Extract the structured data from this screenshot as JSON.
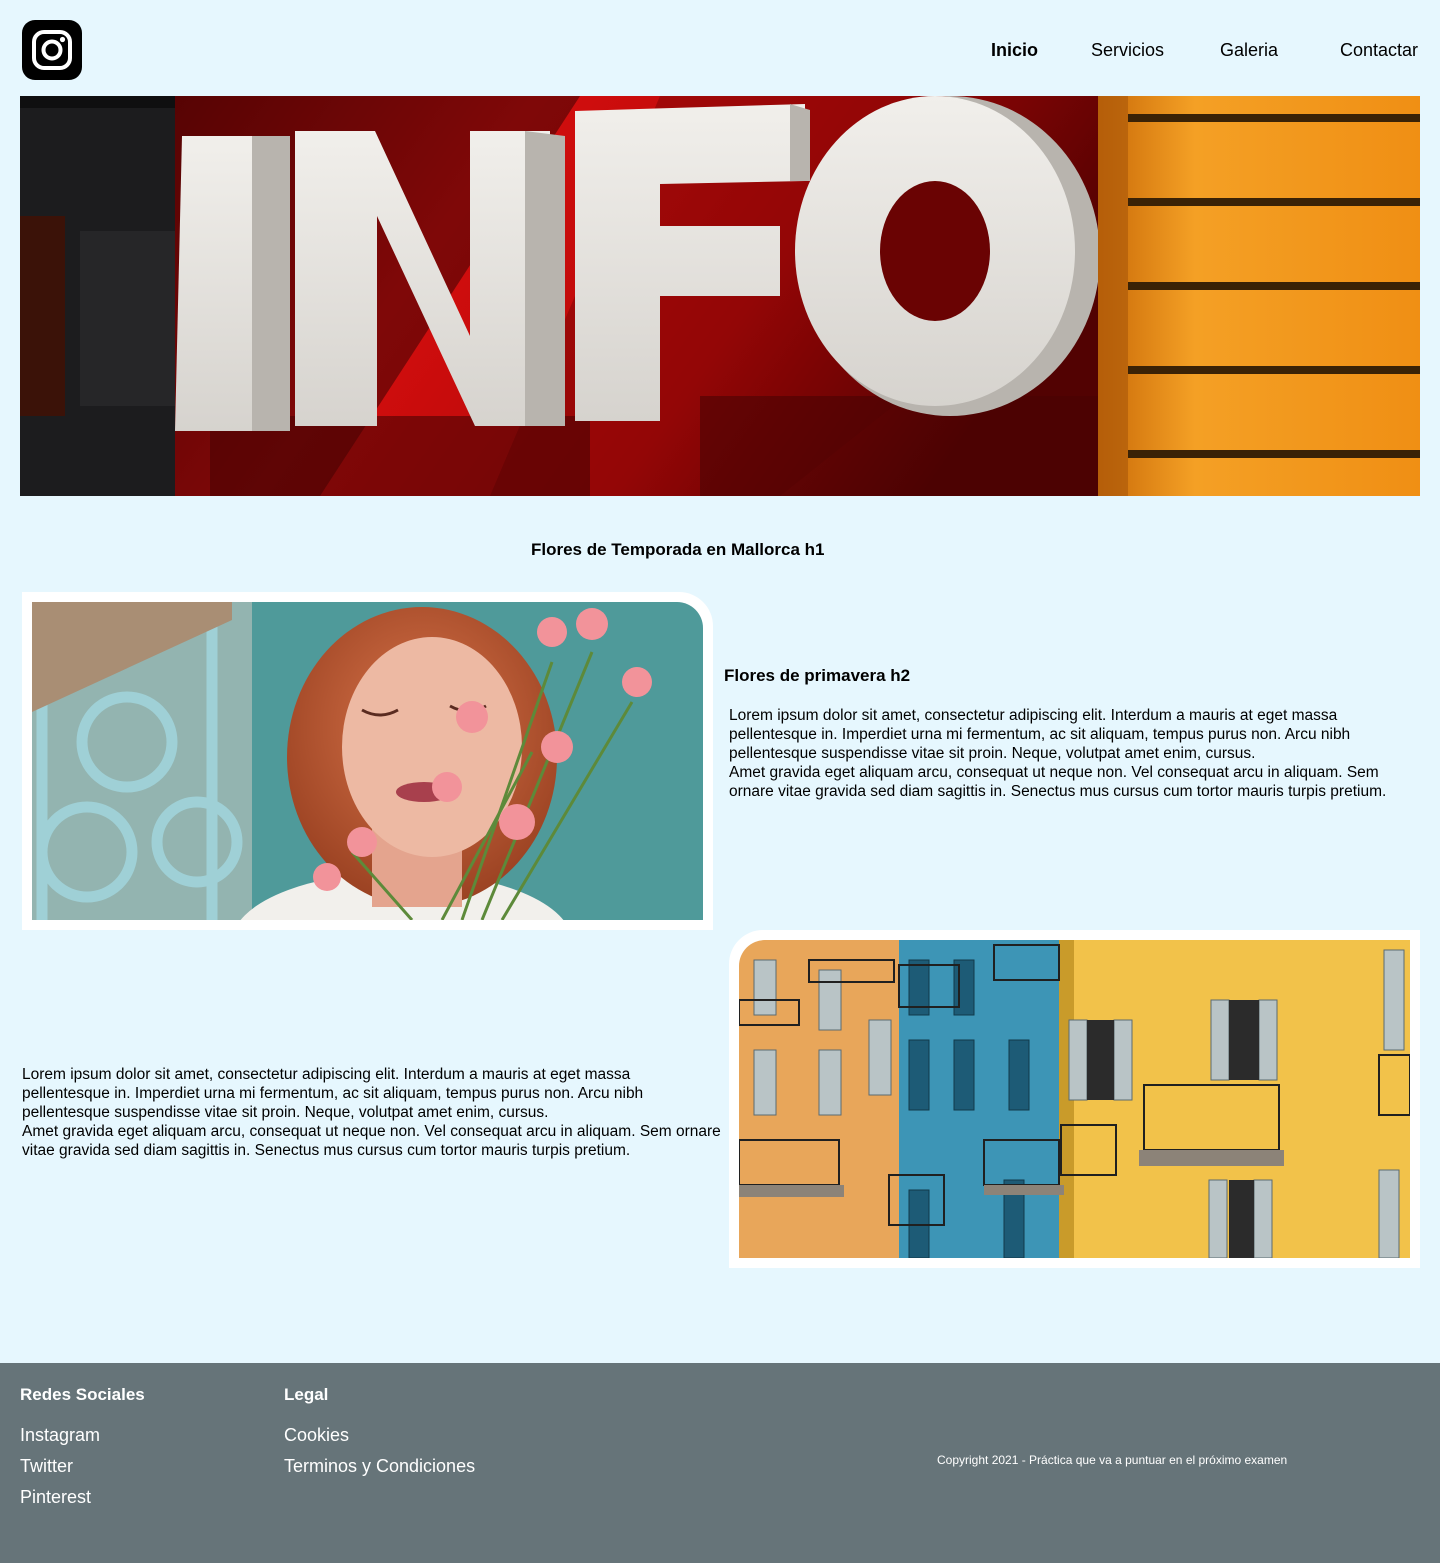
{
  "header": {
    "logo_icon": "instagram-icon",
    "nav": [
      {
        "label": "Inicio",
        "active": true
      },
      {
        "label": "Servicios",
        "active": false
      },
      {
        "label": "Galeria",
        "active": false
      },
      {
        "label": "Contactar",
        "active": false
      }
    ]
  },
  "hero": {
    "sign_text": "INFO",
    "colors": {
      "red": "#c80a0a",
      "orange": "#f29a1c",
      "white": "#e8e6e2"
    }
  },
  "main": {
    "h1": "Flores de Temporada en Mallorca h1",
    "section1": {
      "h2": "Flores de primavera  h2",
      "paragraph": "Lorem ipsum dolor sit amet, consectetur adipiscing elit. Interdum a mauris at eget massa pellentesque in. Imperdiet urna mi fermentum, ac sit aliquam, tempus purus non. Arcu nibh pellentesque suspendisse vitae sit proin. Neque, volutpat amet enim, cursus.\nAmet gravida eget aliquam arcu, consequat ut neque non. Vel consequat arcu in aliquam. Sem ornare vitae gravida sed diam sagittis in. Senectus mus cursus cum tortor mauris turpis pretium."
    },
    "section2": {
      "paragraph": "Lorem ipsum dolor sit amet, consectetur adipiscing elit. Interdum a mauris at eget massa pellentesque in. Imperdiet urna mi fermentum, ac sit aliquam, tempus purus non. Arcu nibh pellentesque suspendisse vitae sit proin. Neque, volutpat amet enim, cursus.\nAmet gravida eget aliquam arcu, consequat ut neque non. Vel consequat arcu in aliquam. Sem ornare vitae gravida sed diam sagittis in. Senectus mus cursus cum tortor mauris turpis pretium."
    }
  },
  "footer": {
    "social_heading": "Redes Sociales",
    "social_links": [
      "Instagram",
      "Twitter",
      "Pinterest"
    ],
    "legal_heading": "Legal",
    "legal_links": [
      "Cookies",
      "Terminos y Condiciones"
    ],
    "copyright": "Copyright 2021 - Práctica que va a puntuar en el próximo examen"
  },
  "colors": {
    "page_background": "#e6f7fe",
    "footer_background": "#667479",
    "frame": "#ffffff"
  }
}
